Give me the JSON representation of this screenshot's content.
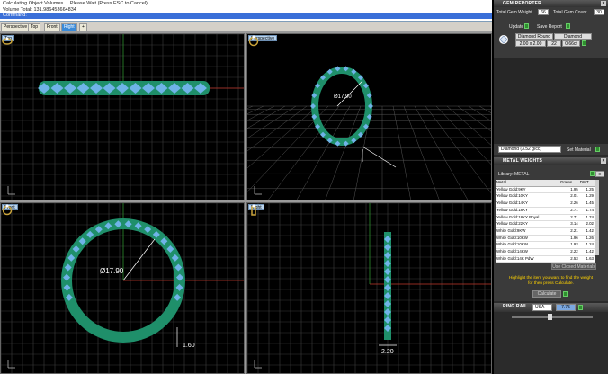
{
  "command": {
    "lines": [
      "Calculating Object Volumes....   Please Wait (Press ESC to Cancel)",
      "Volume Total: 131.986453664834",
      "Command:"
    ]
  },
  "tabs": [
    "Perspective",
    "Top",
    "Front",
    "Right"
  ],
  "active_tab": "Right",
  "viewports": {
    "top": {
      "label": "Top",
      "icon": "ring-view-icon"
    },
    "perspective": {
      "label": "Perspective",
      "icon": "ring-view-icon",
      "dimension": "Ø17.90"
    },
    "front": {
      "label": "Front",
      "icon": "ring-view-icon",
      "dimension": "Ø17.90",
      "thickness": "1.60"
    },
    "right": {
      "label": "Right",
      "icon": "ring-view-icon",
      "width": "2.20"
    }
  },
  "gem_reporter": {
    "title": "GEM REPORTER",
    "total_weight_label": "Total Gem Weight",
    "total_weight_value": "66",
    "total_count_label": "Total Gem Count",
    "total_count_value": "30",
    "update_label": "Update",
    "save_report_label": "Save Report",
    "gem_shape": "Diamond Round",
    "gem_material": "Diamond",
    "gem_size": "2.00 x 2.00",
    "gem_count": "22",
    "gem_weight": "0.66ct",
    "material_select": "Diamond   (3.52 g/cc)",
    "set_material_label": "Set Material"
  },
  "metal_weights": {
    "title": "METAL WEIGHTS",
    "library_label": "Library: METAL",
    "headers": [
      "Metal",
      "Grams",
      "DWT"
    ],
    "rows": [
      [
        "Yellow Gold:9KY",
        "1.95",
        "1.25"
      ],
      [
        "Yellow Gold:10KY",
        "2.01",
        "1.29"
      ],
      [
        "Yellow Gold:14KY",
        "2.26",
        "1.45"
      ],
      [
        "Yellow Gold:18KY",
        "2.71",
        "1.74"
      ],
      [
        "Yellow Gold:18KY Royal",
        "2.71",
        "1.74"
      ],
      [
        "Yellow Gold:22KY",
        "3.14",
        "2.02"
      ],
      [
        "White Gold:9KW",
        "2.21",
        "1.42"
      ],
      [
        "White Gold:10KW",
        "1.96",
        "1.26"
      ],
      [
        "White Gold:10KW",
        "1.93",
        "1.24"
      ],
      [
        "White Gold:14KW",
        "2.22",
        "1.42"
      ],
      [
        "White Gold:14K PdW",
        "2.53",
        "1.63"
      ]
    ],
    "tab_label": "Use Closed Materials",
    "hint_lines": [
      "Highlight the item you want to find the weight",
      "for then press Calculate."
    ],
    "calculate_label": "Calculate"
  },
  "ring_rail": {
    "title": "RING RAIL",
    "standard": "USA",
    "size": "7.75"
  },
  "colors": {
    "ring": "#1f8f6a",
    "gem": "#6fb3e8",
    "grid": "#3b3b3b",
    "accent_tab": "#3a8ad8"
  }
}
